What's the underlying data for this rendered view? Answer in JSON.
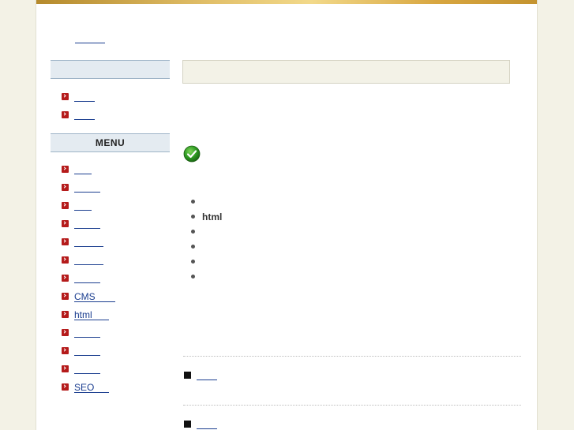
{
  "colors": {
    "background": "#f3f2e6",
    "page": "#ffffff",
    "top_bar": "#d8a640",
    "sidebar_header": "#e4ebf1",
    "link": "#1a3d8f",
    "arrow_bullet": "#b51b1b",
    "main_box": "#f3f2e7"
  },
  "header": {
    "site_link": ""
  },
  "sidebar": {
    "top_heading": "",
    "top_items": [
      {
        "label": ""
      },
      {
        "label": ""
      }
    ],
    "menu_heading": "MENU",
    "menu_items": [
      {
        "label": ""
      },
      {
        "label": ""
      },
      {
        "label": ""
      },
      {
        "label": ""
      },
      {
        "label": ""
      },
      {
        "label": ""
      },
      {
        "label": ""
      },
      {
        "label": "CMS"
      },
      {
        "label": "html"
      },
      {
        "label": ""
      },
      {
        "label": ""
      },
      {
        "label": ""
      },
      {
        "label": "SEO"
      }
    ]
  },
  "main": {
    "status_icon": "check-circle-icon",
    "bullets": [
      "",
      "html",
      "",
      "",
      "",
      ""
    ],
    "news": [
      {
        "label": ""
      },
      {
        "label": ""
      }
    ]
  }
}
